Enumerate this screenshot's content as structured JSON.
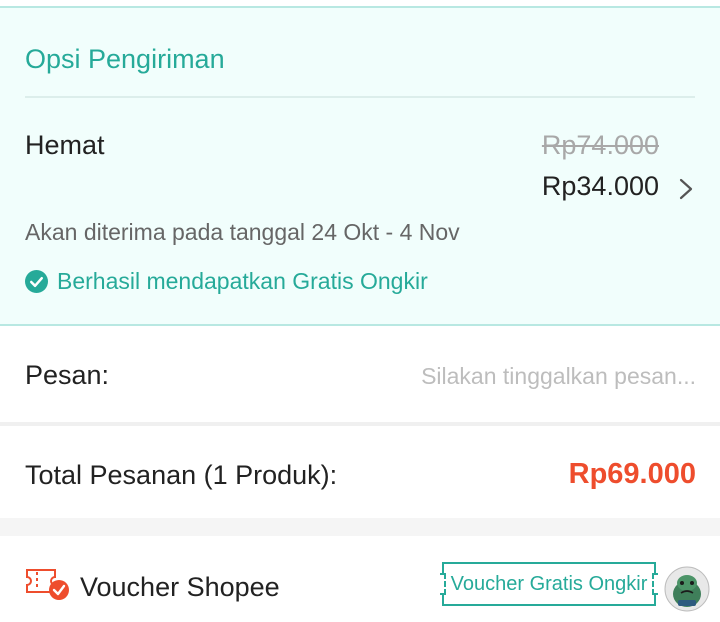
{
  "shipping": {
    "title": "Opsi Pengiriman",
    "method_name": "Hemat",
    "original_price": "Rp74.000",
    "price": "Rp34.000",
    "eta": "Akan diterima pada tanggal 24 Okt - 4 Nov",
    "free_shipping_text": "Berhasil mendapatkan Gratis Ongkir"
  },
  "message": {
    "label": "Pesan:",
    "placeholder": "Silakan tinggalkan pesan...",
    "value": ""
  },
  "order_total": {
    "label": "Total Pesanan (1 Produk):",
    "value": "Rp69.000"
  },
  "voucher": {
    "label": "Voucher Shopee",
    "tag": "Voucher Gratis Ongkir"
  },
  "icons": {
    "chevron": "chevron-right-icon",
    "check": "check-circle-icon",
    "voucher": "voucher-ticket-icon",
    "avatar": "user-avatar"
  },
  "colors": {
    "accent": "#26aa99",
    "price": "#ee4d2d",
    "shipping_bg": "#f1fefc"
  }
}
